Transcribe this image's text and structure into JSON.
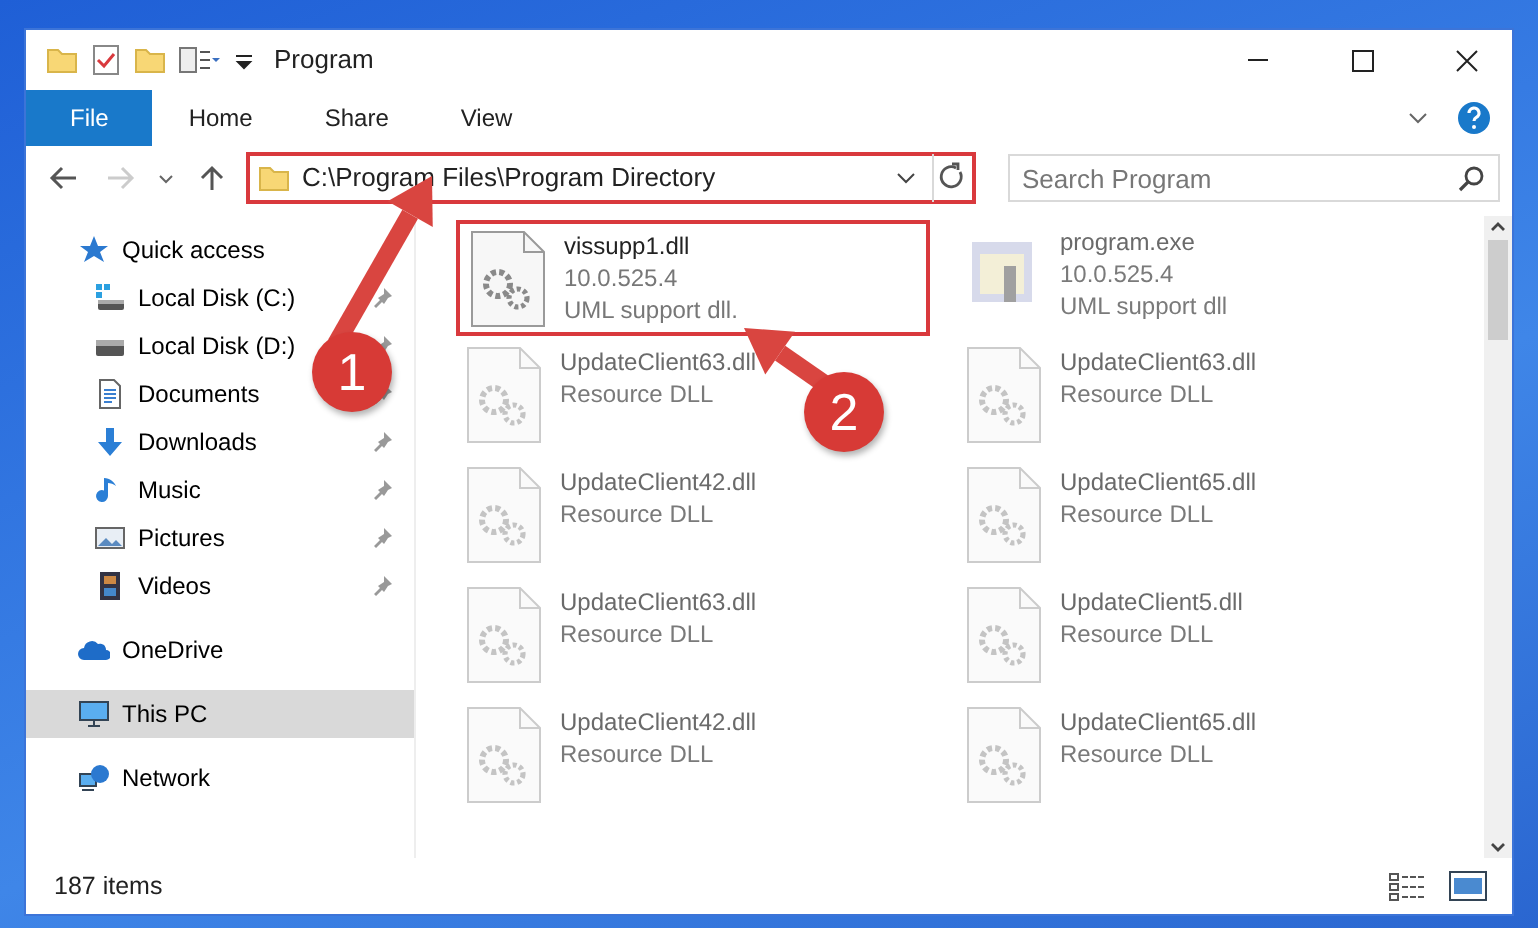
{
  "window": {
    "title": "Program"
  },
  "ribbon_tabs": [
    {
      "label": "File",
      "kind": "file"
    },
    {
      "label": "Home",
      "kind": "tab"
    },
    {
      "label": "Share",
      "kind": "tab"
    },
    {
      "label": "View",
      "kind": "tab"
    }
  ],
  "address_bar": {
    "path": "C:\\Program Files\\Program Directory",
    "highlighted": true
  },
  "search": {
    "placeholder": "Search Program"
  },
  "nav": [
    {
      "label": "Quick access",
      "kind": "star",
      "selected": false,
      "children": [
        {
          "label": "Local Disk (C:)",
          "kind": "disk-c",
          "pinned": true,
          "selected": false
        },
        {
          "label": "Local Disk (D:)",
          "kind": "disk",
          "pinned": true,
          "selected": false
        },
        {
          "label": "Documents",
          "kind": "documents",
          "pinned": true,
          "selected": false
        },
        {
          "label": "Downloads",
          "kind": "downloads",
          "pinned": true,
          "selected": false
        },
        {
          "label": "Music",
          "kind": "music",
          "pinned": true,
          "selected": false
        },
        {
          "label": "Pictures",
          "kind": "pictures",
          "pinned": true,
          "selected": false
        },
        {
          "label": "Videos",
          "kind": "videos",
          "pinned": true,
          "selected": false
        }
      ]
    },
    {
      "label": "OneDrive",
      "kind": "cloud",
      "selected": false
    },
    {
      "label": "This PC",
      "kind": "pc",
      "selected": true
    },
    {
      "label": "Network",
      "kind": "network",
      "selected": false
    }
  ],
  "files": [
    {
      "name": "vissupp1.dll",
      "lines": [
        "10.0.525.4",
        "UML support dll."
      ],
      "kind": "dll",
      "highlighted": true,
      "blurred": false
    },
    {
      "name": "program.exe",
      "lines": [
        "10.0.525.4",
        "UML support dll"
      ],
      "kind": "exe",
      "highlighted": false,
      "blurred": true
    },
    {
      "name": "UpdateClient63.dll",
      "lines": [
        "Resource DLL"
      ],
      "kind": "dll",
      "highlighted": false,
      "blurred": true
    },
    {
      "name": "UpdateClient63.dll",
      "lines": [
        "Resource DLL"
      ],
      "kind": "dll",
      "highlighted": false,
      "blurred": true
    },
    {
      "name": "UpdateClient42.dll",
      "lines": [
        "Resource DLL"
      ],
      "kind": "dll",
      "highlighted": false,
      "blurred": true
    },
    {
      "name": "UpdateClient65.dll",
      "lines": [
        "Resource DLL"
      ],
      "kind": "dll",
      "highlighted": false,
      "blurred": true
    },
    {
      "name": "UpdateClient63.dll",
      "lines": [
        "Resource DLL"
      ],
      "kind": "dll",
      "highlighted": false,
      "blurred": true
    },
    {
      "name": "UpdateClient5.dll",
      "lines": [
        "Resource DLL"
      ],
      "kind": "dll",
      "highlighted": false,
      "blurred": true
    },
    {
      "name": "UpdateClient42.dll",
      "lines": [
        "Resource DLL"
      ],
      "kind": "dll",
      "highlighted": false,
      "blurred": true
    },
    {
      "name": "UpdateClient65.dll",
      "lines": [
        "Resource DLL"
      ],
      "kind": "dll",
      "highlighted": false,
      "blurred": true
    }
  ],
  "status_bar": {
    "item_count": "187 items"
  },
  "annotations": [
    {
      "label": "1"
    },
    {
      "label": "2"
    }
  ]
}
